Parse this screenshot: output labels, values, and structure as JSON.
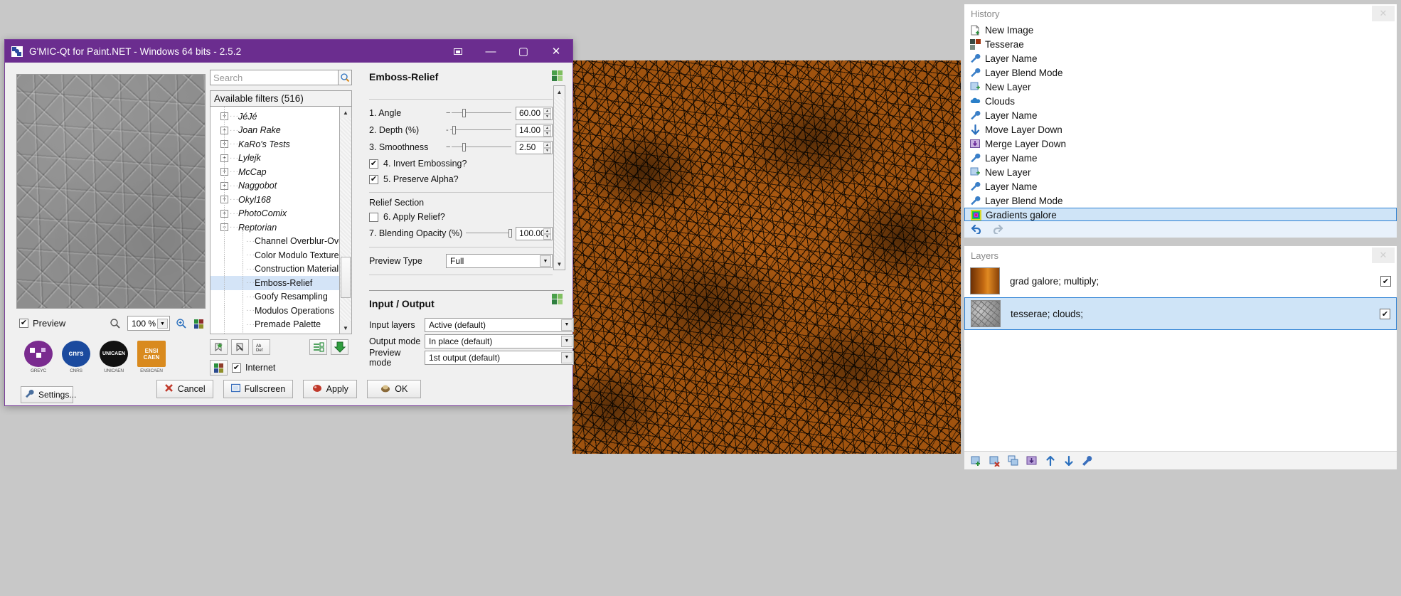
{
  "gmic": {
    "title": "G'MIC-Qt for Paint.NET - Windows 64 bits - 2.5.2",
    "app_icon": "gmic-icon",
    "titlebar_buttons": {
      "extra": "⧉",
      "minimize": "—",
      "maximize": "▢",
      "close": "✕"
    },
    "preview": {
      "checkbox_label": "Preview",
      "checked": true,
      "zoom_value": "100 %",
      "magnifier_icon": "magnifier-icon",
      "zoom_in_icon": "zoom-in-icon",
      "refresh_icon": "refresh-preview-icon"
    },
    "logos": [
      {
        "name": "GREYC",
        "abbr": "",
        "caption": "GREYC",
        "color": "#7a2b8f"
      },
      {
        "name": "CNRS",
        "abbr": "cnrs",
        "caption": "CNRS",
        "color": "#1b4a9e"
      },
      {
        "name": "UNICAEN",
        "abbr": "UNICAEN",
        "caption": "UNICAEN",
        "color": "#111111"
      },
      {
        "name": "ENSICAEN",
        "abbr": "ENSI CAEN",
        "caption": "ENSICAEN",
        "color": "#d98a1e"
      }
    ],
    "settings_button": "Settings...",
    "settings_icon": "wrench-icon",
    "search": {
      "placeholder": "Search",
      "value": "",
      "go_icon": "search-icon"
    },
    "filters_header": "Available filters (516)",
    "tree": [
      {
        "label": "JéJé",
        "type": "group",
        "expander": "+"
      },
      {
        "label": "Joan Rake",
        "type": "group",
        "expander": "+"
      },
      {
        "label": "KaRo's Tests",
        "type": "group",
        "expander": "+"
      },
      {
        "label": "Lylejk",
        "type": "group",
        "expander": "+"
      },
      {
        "label": "McCap",
        "type": "group",
        "expander": "+"
      },
      {
        "label": "Naggobot",
        "type": "group",
        "expander": "+"
      },
      {
        "label": "Okyl168",
        "type": "group",
        "expander": "+"
      },
      {
        "label": "PhotoComix",
        "type": "group",
        "expander": "+"
      },
      {
        "label": "Reptorian",
        "type": "group",
        "expander": "−"
      },
      {
        "label": "Channel Overblur-Overlin",
        "type": "leaf",
        "selected": false
      },
      {
        "label": "Color Modulo Texture",
        "type": "leaf",
        "selected": false
      },
      {
        "label": "Construction Material Tex",
        "type": "leaf",
        "selected": false
      },
      {
        "label": "Emboss-Relief",
        "type": "leaf",
        "selected": true
      },
      {
        "label": "Goofy Resampling",
        "type": "leaf",
        "selected": false
      },
      {
        "label": "Modulos Operations",
        "type": "leaf",
        "selected": false
      },
      {
        "label": "Premade Palette",
        "type": "leaf",
        "selected": false
      }
    ],
    "mid_buttons": {
      "add_fave_icon": "add-favorite-icon",
      "remove_fave_icon": "remove-favorite-icon",
      "rename_icon": "rename-abc-icon",
      "expand_icon": "expand-all-icon",
      "collapse_icon": "collapse-down-icon",
      "update_icon": "update-filters-icon",
      "internet_label": "Internet",
      "internet_checked": true
    },
    "filter_title": "Emboss-Relief",
    "params_gear_icon": "params-gear-icon",
    "params": [
      {
        "label": "1. Angle",
        "value": "60.00",
        "handle_pct": 17,
        "min_mark": "−"
      },
      {
        "label": "2. Depth (%)",
        "value": "14.00",
        "handle_pct": 4,
        "min_mark": "-"
      },
      {
        "label": "3. Smoothness",
        "value": "2.50",
        "handle_pct": 17,
        "min_mark": "−"
      }
    ],
    "checkboxes": [
      {
        "label": "4. Invert Embossing?",
        "checked": true
      },
      {
        "label": "5. Preserve Alpha?",
        "checked": true
      }
    ],
    "relief_section_label": "Relief Section",
    "relief_checkbox": {
      "label": "6. Apply Relief?",
      "checked": false
    },
    "blending": {
      "label": "7. Blending Opacity (%)",
      "value": "100.00",
      "handle_pct": 97
    },
    "preview_type": {
      "label": "Preview Type",
      "value": "Full"
    },
    "io_title": "Input / Output",
    "io_gear_icon": "io-gear-icon",
    "io": [
      {
        "label": "Input layers",
        "value": "Active (default)"
      },
      {
        "label": "Output mode",
        "value": "In place (default)"
      },
      {
        "label": "Preview mode",
        "value": "1st output (default)"
      }
    ],
    "dialog_buttons": [
      {
        "label": "Cancel",
        "icon": "cancel-x-icon"
      },
      {
        "label": "Fullscreen",
        "icon": "fullscreen-icon"
      },
      {
        "label": "Apply",
        "icon": "apply-icon"
      },
      {
        "label": "OK",
        "icon": "ok-icon"
      }
    ]
  },
  "history": {
    "title": "History",
    "close_icon": "close-icon",
    "items": [
      {
        "label": "New Image",
        "icon": "new-image-icon",
        "selected": false
      },
      {
        "label": "Tesserae",
        "icon": "tesserae-icon",
        "selected": false
      },
      {
        "label": "Layer Name",
        "icon": "wrench-icon",
        "selected": false
      },
      {
        "label": "Layer Blend Mode",
        "icon": "wrench-icon",
        "selected": false
      },
      {
        "label": "New Layer",
        "icon": "new-layer-icon",
        "selected": false
      },
      {
        "label": "Clouds",
        "icon": "clouds-icon",
        "selected": false
      },
      {
        "label": "Layer Name",
        "icon": "wrench-icon",
        "selected": false
      },
      {
        "label": "Move Layer Down",
        "icon": "move-layer-down-icon",
        "selected": false
      },
      {
        "label": "Merge Layer Down",
        "icon": "merge-layer-down-icon",
        "selected": false
      },
      {
        "label": "Layer Name",
        "icon": "wrench-icon",
        "selected": false
      },
      {
        "label": "New Layer",
        "icon": "new-layer-icon",
        "selected": false
      },
      {
        "label": "Layer Name",
        "icon": "wrench-icon",
        "selected": false
      },
      {
        "label": "Layer Blend Mode",
        "icon": "wrench-icon",
        "selected": false
      },
      {
        "label": "Gradients galore",
        "icon": "gradients-icon",
        "selected": true
      }
    ],
    "undo_icon": "undo-icon",
    "redo_icon": "redo-icon"
  },
  "layers": {
    "title": "Layers",
    "close_icon": "close-icon",
    "items": [
      {
        "name": "grad galore; multiply;",
        "visible": true,
        "selected": false,
        "thumb": "orange-gradient"
      },
      {
        "name": "tesserae; clouds;",
        "visible": true,
        "selected": true,
        "thumb": "grey-tesserae"
      }
    ],
    "toolbar": [
      {
        "icon": "add-layer-icon"
      },
      {
        "icon": "delete-layer-icon"
      },
      {
        "icon": "duplicate-layer-icon"
      },
      {
        "icon": "merge-layer-down-icon"
      },
      {
        "icon": "move-layer-up-icon"
      },
      {
        "icon": "move-layer-down-icon"
      },
      {
        "icon": "layer-properties-icon"
      }
    ]
  },
  "colors": {
    "title_purple": "#6b2d8f",
    "selection_blue": "#cfe4f7",
    "selection_border": "#2a7fd4",
    "dialog_bg": "#f0f0f0",
    "desktop_grey": "#c8c8c8"
  }
}
